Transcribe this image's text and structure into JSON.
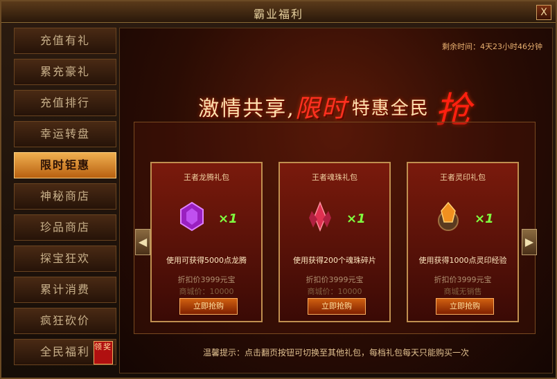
{
  "window": {
    "title": "霸业福利",
    "close_label": "X"
  },
  "sidebar": {
    "items": [
      {
        "label": "充值有礼",
        "active": false
      },
      {
        "label": "累充豪礼",
        "active": false
      },
      {
        "label": "充值排行",
        "active": false
      },
      {
        "label": "幸运转盘",
        "active": false
      },
      {
        "label": "限时钜惠",
        "active": true
      },
      {
        "label": "神秘商店",
        "active": false
      },
      {
        "label": "珍品商店",
        "active": false
      },
      {
        "label": "探宝狂欢",
        "active": false
      },
      {
        "label": "累计消费",
        "active": false
      },
      {
        "label": "疯狂砍价",
        "active": false
      },
      {
        "label": "全民福利",
        "active": false
      }
    ],
    "badge_label": "领奖"
  },
  "main": {
    "remaining_time": "剩余时间：4天23小时46分钟",
    "banner": {
      "part1": "激情共享,",
      "part2": "限时",
      "part3": "特惠全民",
      "part4": "抢"
    },
    "cards": [
      {
        "name": "王者龙腾礼包",
        "gem": "purple-gem-icon",
        "qty": "×1",
        "desc": "使用可获得5000点龙腾",
        "price": "折扣价3999元宝",
        "mall": "商城价：10000",
        "button": "立即抢购"
      },
      {
        "name": "王者魂珠礼包",
        "gem": "red-crystal-icon",
        "qty": "×1",
        "desc": "使用获得200个魂珠碎片",
        "price": "折扣价3999元宝",
        "mall": "商城价：10000",
        "button": "立即抢购"
      },
      {
        "name": "王者灵印礼包",
        "gem": "orange-seal-icon",
        "qty": "×1",
        "desc": "使用获得1000点灵印经验",
        "price": "折扣价3999元宝",
        "mall": "商城无销售",
        "button": "立即抢购"
      }
    ],
    "tip": "温馨提示：点击翻页按钮可切换至其他礼包，每档礼包每天只能购买一次"
  },
  "colors": {
    "accent": "#f0b050",
    "buy_button": "#d06010",
    "qty_green": "#80ff40"
  }
}
